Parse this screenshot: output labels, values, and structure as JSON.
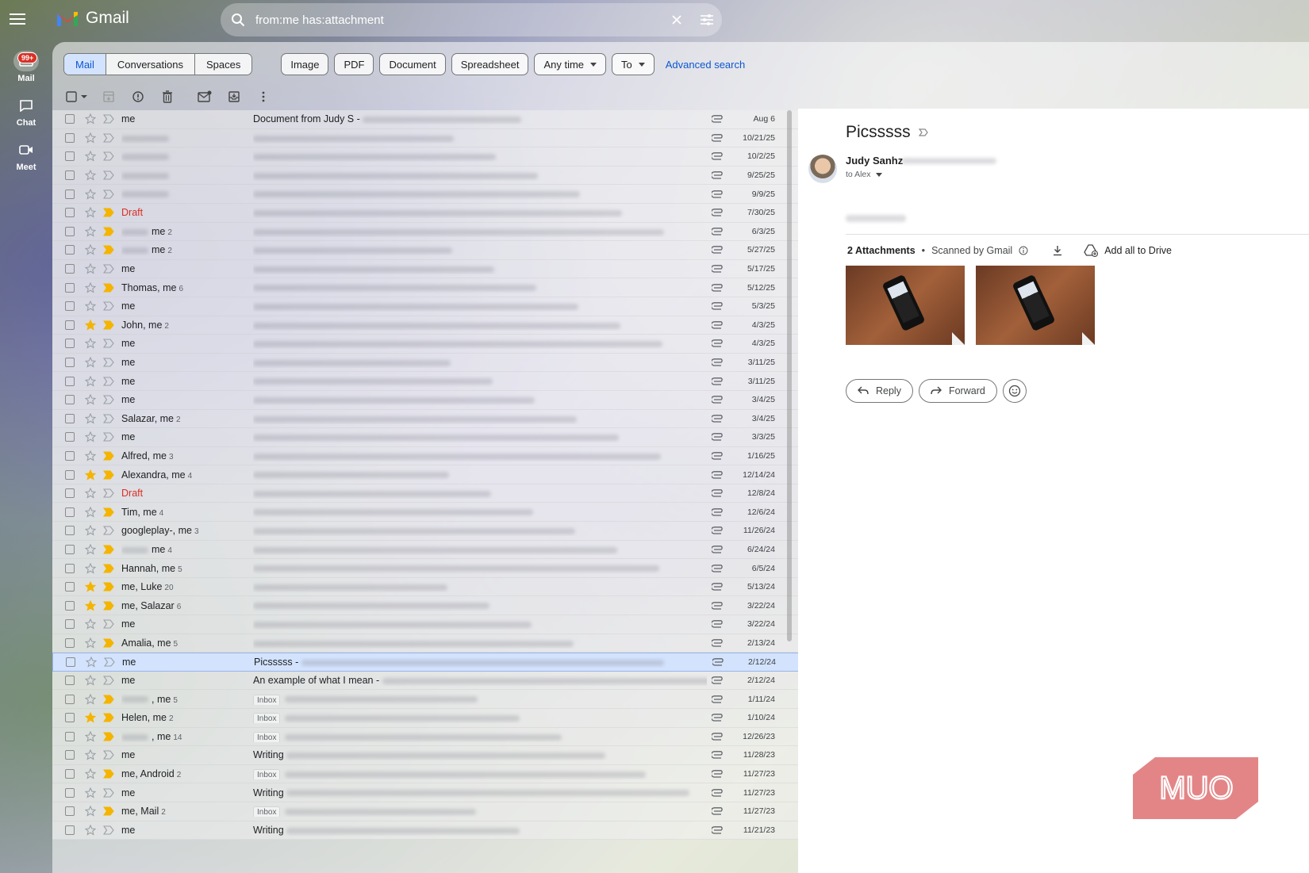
{
  "app": {
    "name": "Gmail"
  },
  "search": {
    "query": "from:me has:attachment"
  },
  "rail": [
    {
      "label": "Mail",
      "badge": "99+",
      "icon": "mail-icon"
    },
    {
      "label": "Chat",
      "icon": "chat-icon"
    },
    {
      "label": "Meet",
      "icon": "meet-icon"
    }
  ],
  "filters": {
    "segments": [
      "Mail",
      "Conversations",
      "Spaces"
    ],
    "chips": [
      "Image",
      "PDF",
      "Document",
      "Spreadsheet"
    ],
    "dropdowns": [
      "Any time",
      "To"
    ],
    "advanced": "Advanced search"
  },
  "emails": [
    {
      "sender": "me",
      "count": "",
      "subject": "Document from Judy S -",
      "date": "Aug 6",
      "star": false,
      "imp": false
    },
    {
      "sender": "",
      "count": "",
      "subject": "",
      "date": "10/21/25",
      "star": false,
      "imp": false
    },
    {
      "sender": "",
      "count": "",
      "subject": "",
      "date": "10/2/25",
      "star": false,
      "imp": false
    },
    {
      "sender": "",
      "count": "",
      "subject": "",
      "date": "9/25/25",
      "star": false,
      "imp": false
    },
    {
      "sender": "",
      "count": "",
      "subject": "",
      "date": "9/9/25",
      "star": false,
      "imp": false
    },
    {
      "sender": "Draft",
      "count": "",
      "subject": "",
      "date": "7/30/25",
      "star": false,
      "imp": true,
      "draft": true
    },
    {
      "sender": "me",
      "count": "2",
      "subject": "",
      "date": "6/3/25",
      "star": false,
      "imp": true
    },
    {
      "sender": "me",
      "count": "2",
      "subject": "",
      "date": "5/27/25",
      "star": false,
      "imp": true
    },
    {
      "sender": "me",
      "count": "",
      "subject": "",
      "date": "5/17/25",
      "star": false,
      "imp": false
    },
    {
      "sender": "Thomas, me",
      "count": "6",
      "subject": "",
      "date": "5/12/25",
      "star": false,
      "imp": true
    },
    {
      "sender": "me",
      "count": "",
      "subject": "",
      "date": "5/3/25",
      "star": false,
      "imp": false
    },
    {
      "sender": "John, me",
      "count": "2",
      "subject": "",
      "date": "4/3/25",
      "star": true,
      "imp": true
    },
    {
      "sender": "me",
      "count": "",
      "subject": "",
      "date": "4/3/25",
      "star": false,
      "imp": false
    },
    {
      "sender": "me",
      "count": "",
      "subject": "",
      "date": "3/11/25",
      "star": false,
      "imp": false
    },
    {
      "sender": "me",
      "count": "",
      "subject": "",
      "date": "3/11/25",
      "star": false,
      "imp": false
    },
    {
      "sender": "me",
      "count": "",
      "subject": "",
      "date": "3/4/25",
      "star": false,
      "imp": false
    },
    {
      "sender": "Salazar, me",
      "count": "2",
      "subject": "",
      "date": "3/4/25",
      "star": false,
      "imp": false
    },
    {
      "sender": "me",
      "count": "",
      "subject": "",
      "date": "3/3/25",
      "star": false,
      "imp": false
    },
    {
      "sender": "Alfred, me",
      "count": "3",
      "subject": "",
      "date": "1/16/25",
      "star": false,
      "imp": true
    },
    {
      "sender": "Alexandra, me",
      "count": "4",
      "subject": "",
      "date": "12/14/24",
      "star": true,
      "imp": true
    },
    {
      "sender": "Draft",
      "count": "",
      "subject": "",
      "date": "12/8/24",
      "star": false,
      "imp": false,
      "draft": true
    },
    {
      "sender": "Tim, me",
      "count": "4",
      "subject": "",
      "date": "12/6/24",
      "star": false,
      "imp": true
    },
    {
      "sender": "googleplay-, me",
      "count": "3",
      "subject": "",
      "date": "11/26/24",
      "star": false,
      "imp": false
    },
    {
      "sender": "me",
      "count": "4",
      "subject": "",
      "date": "6/24/24",
      "star": false,
      "imp": true
    },
    {
      "sender": "Hannah, me",
      "count": "5",
      "subject": "",
      "date": "6/5/24",
      "star": false,
      "imp": true
    },
    {
      "sender": "me, Luke",
      "count": "20",
      "subject": "",
      "date": "5/13/24",
      "star": true,
      "imp": true
    },
    {
      "sender": "me, Salazar",
      "count": "6",
      "subject": "",
      "date": "3/22/24",
      "star": true,
      "imp": true
    },
    {
      "sender": "me",
      "count": "",
      "subject": "",
      "date": "3/22/24",
      "star": false,
      "imp": false
    },
    {
      "sender": "Amalia, me",
      "count": "5",
      "subject": "",
      "date": "2/13/24",
      "star": false,
      "imp": true
    },
    {
      "sender": "me",
      "count": "",
      "subject": "Picsssss -",
      "date": "2/12/24",
      "star": false,
      "imp": false,
      "selected": true
    },
    {
      "sender": "me",
      "count": "",
      "subject": "An example of what I mean -",
      "date": "2/12/24",
      "star": false,
      "imp": false
    },
    {
      "sender": ", me",
      "count": "5",
      "subject": "",
      "label": "Inbox",
      "date": "1/11/24",
      "star": false,
      "imp": true
    },
    {
      "sender": "Helen, me",
      "count": "2",
      "subject": "",
      "label": "Inbox",
      "date": "1/10/24",
      "star": true,
      "imp": true
    },
    {
      "sender": ", me",
      "count": "14",
      "subject": "",
      "label": "Inbox",
      "date": "12/26/23",
      "star": false,
      "imp": true
    },
    {
      "sender": "me",
      "count": "",
      "subject": "Writing",
      "date": "11/28/23",
      "star": false,
      "imp": false
    },
    {
      "sender": "me, Android",
      "count": "2",
      "subject": "",
      "label": "Inbox",
      "date": "11/27/23",
      "star": false,
      "imp": true
    },
    {
      "sender": "me",
      "count": "",
      "subject": "Writing",
      "date": "11/27/23",
      "star": false,
      "imp": false
    },
    {
      "sender": "me, Mail",
      "count": "2",
      "subject": "",
      "label": "Inbox",
      "date": "11/27/23",
      "star": false,
      "imp": true
    },
    {
      "sender": "me",
      "count": "",
      "subject": "Writing",
      "date": "11/21/23",
      "star": false,
      "imp": false
    }
  ],
  "reader": {
    "subject": "Picsssss",
    "from": "Judy Sanhz",
    "to": "to Alex",
    "attachments_count": "2 Attachments",
    "scanned": "Scanned by Gmail",
    "add_drive": "Add all to Drive",
    "reply": "Reply",
    "forward": "Forward"
  },
  "watermark": {
    "text": "MUO"
  },
  "colors": {
    "accent": "#0b57d0",
    "star": "#f4b400",
    "important": "#f4b400",
    "draft": "#d93025",
    "badge": "#d93025",
    "watermark": "#e0787a"
  }
}
